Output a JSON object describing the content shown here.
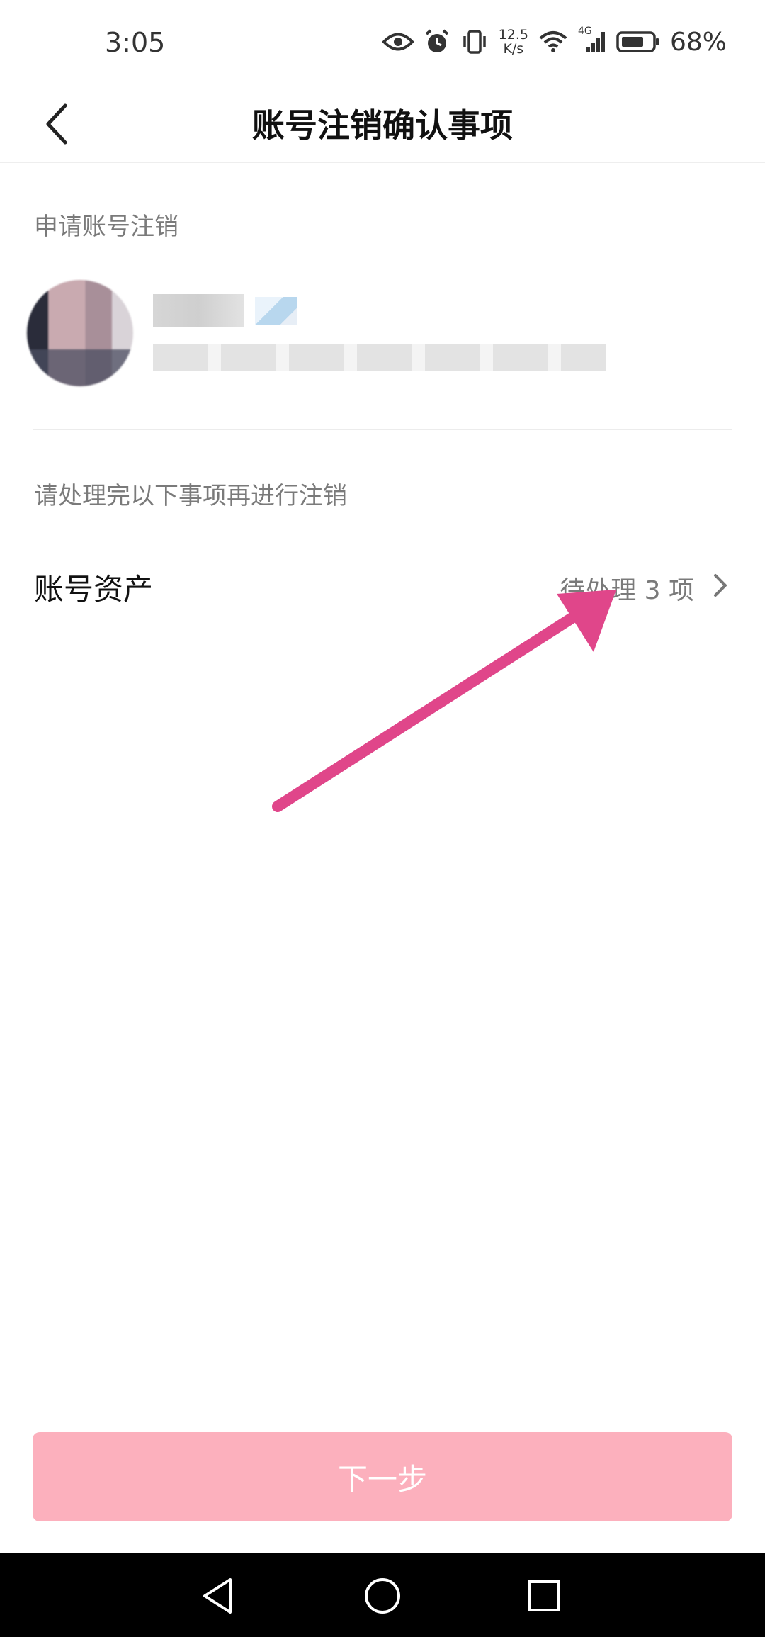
{
  "status_bar": {
    "time": "3:05",
    "net_speed_value": "12.5",
    "net_speed_unit": "K/s",
    "network_type": "4G",
    "battery_percent": "68%",
    "icons": [
      "eye-icon",
      "alarm-icon",
      "vibrate-icon",
      "wifi-icon",
      "signal-icon",
      "battery-icon"
    ]
  },
  "header": {
    "back_icon": "chevron-left-icon",
    "title": "账号注销确认事项"
  },
  "apply_section": {
    "label": "申请账号注销"
  },
  "pending_section": {
    "label": "请处理完以下事项再进行注销"
  },
  "account_assets": {
    "label": "账号资产",
    "status": "待处理 3 项",
    "chevron_icon": "chevron-right-icon"
  },
  "next_button": {
    "label": "下一步"
  },
  "nav_bar": {
    "icons": [
      "back-triangle-icon",
      "home-circle-icon",
      "recents-square-icon"
    ]
  },
  "colors": {
    "next_button_bg": "#fcb0bd",
    "annotation_arrow": "#e0468a",
    "nav_bar_bg": "#000000"
  }
}
